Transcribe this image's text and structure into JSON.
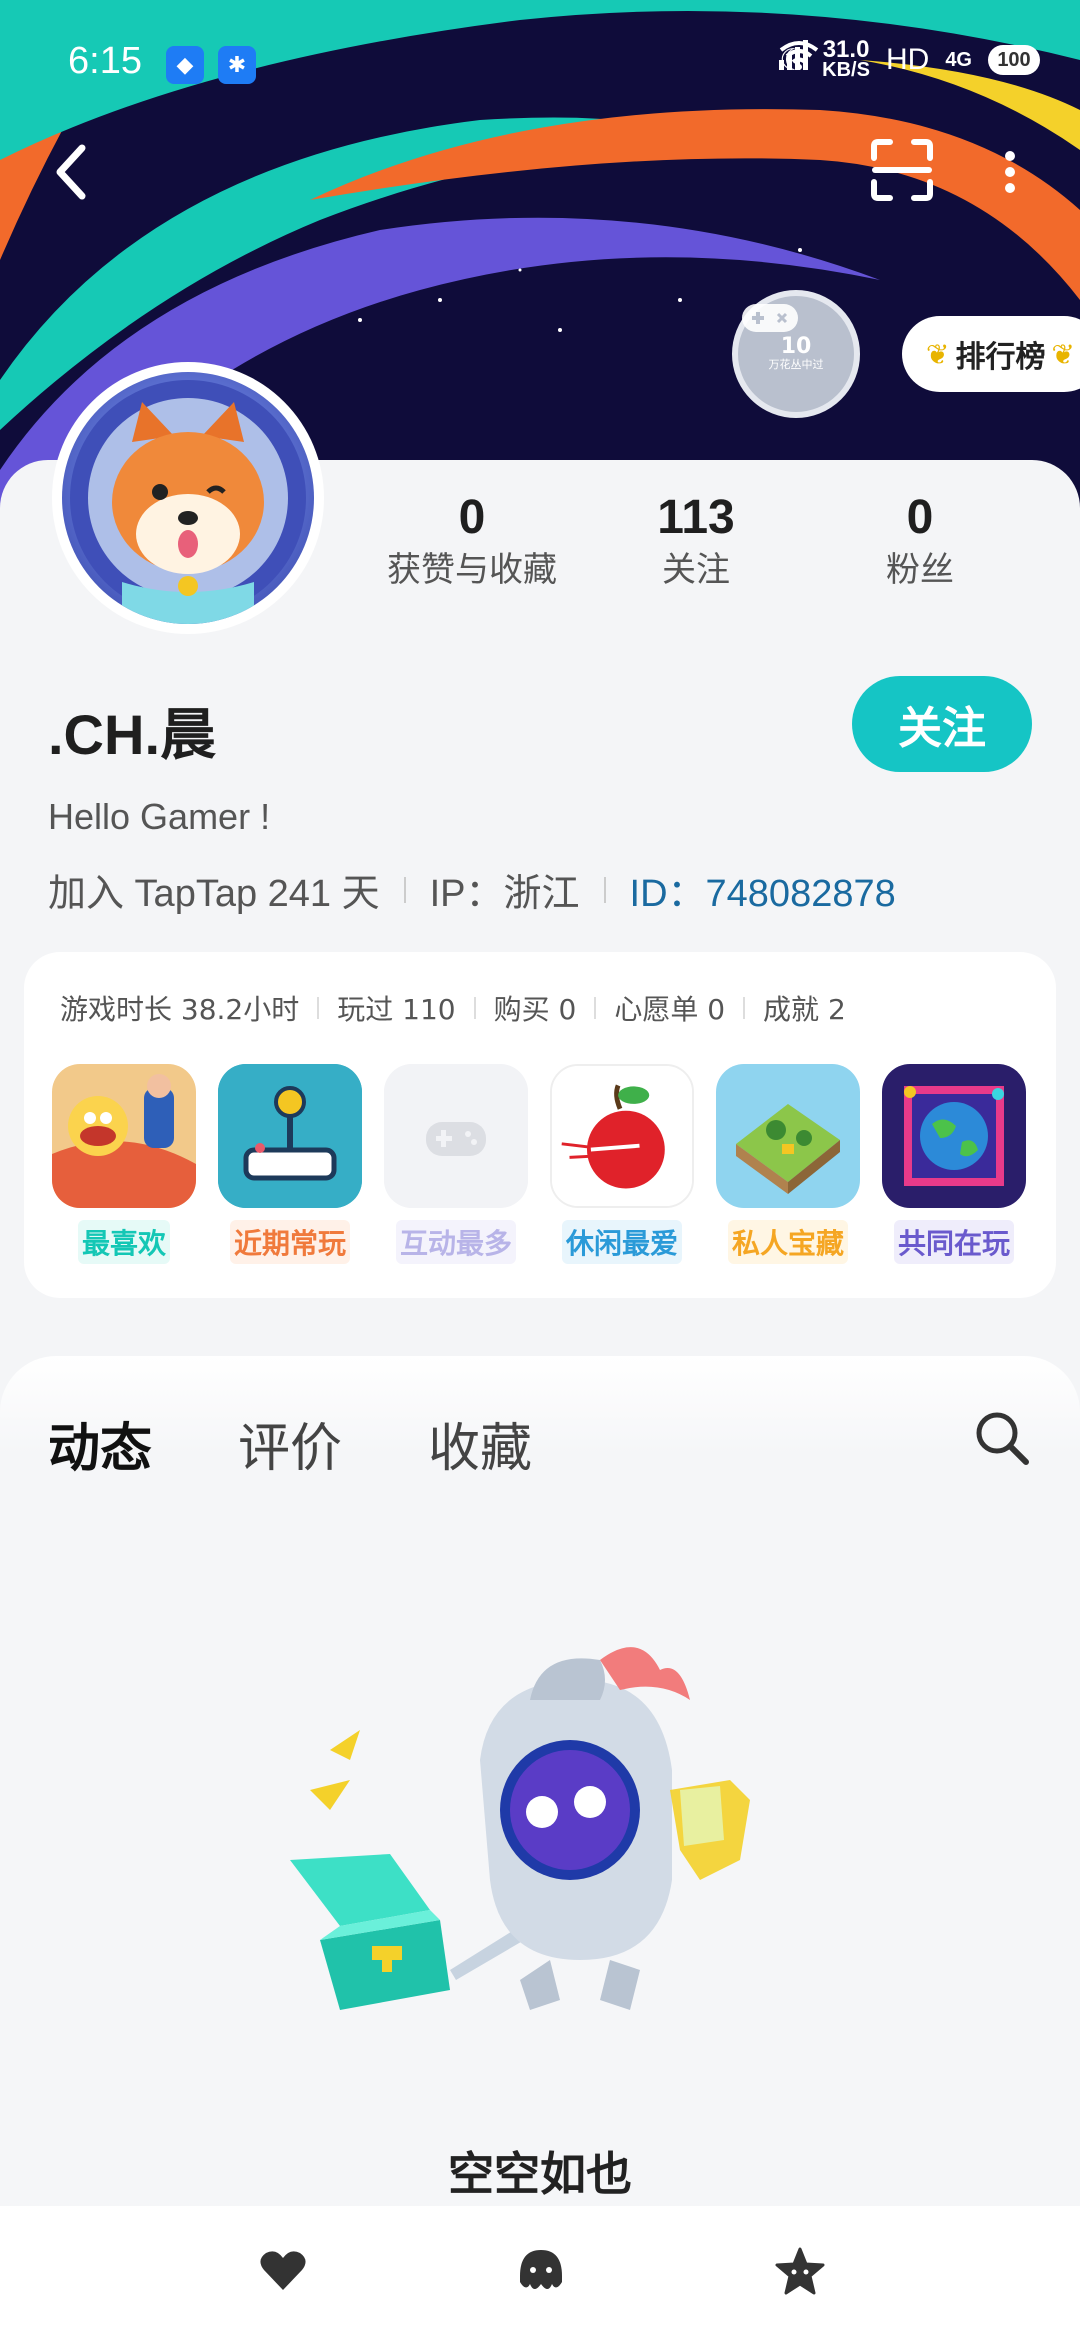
{
  "status_bar": {
    "time": "6:15",
    "speed_value": "31.0",
    "speed_unit": "KB/S",
    "network_hd": "HD",
    "network_gen": "4G",
    "battery": "100"
  },
  "header": {
    "badge_number": "10",
    "badge_text": "万花丛中过",
    "rank_label": "排行榜"
  },
  "profile": {
    "stats": [
      {
        "value": "0",
        "label": "获赞与收藏"
      },
      {
        "value": "113",
        "label": "关注"
      },
      {
        "value": "0",
        "label": "粉丝"
      }
    ],
    "name": ".CH.晨",
    "follow_label": "关注",
    "bio": "Hello Gamer !",
    "joined": "加入 TapTap 241 天",
    "ip": "IP：浙江",
    "id": "ID：748082878"
  },
  "game_card": {
    "stats": [
      "游戏时长 38.2小时",
      "玩过 110",
      "购买 0",
      "心愿单 0",
      "成就 2"
    ],
    "games": [
      {
        "label": "最喜欢",
        "color": "#14c7b5"
      },
      {
        "label": "近期常玩",
        "color": "#f07a3c"
      },
      {
        "label": "互动最多",
        "color": "#b8b4e8"
      },
      {
        "label": "休闲最爱",
        "color": "#2a9ad8"
      },
      {
        "label": "私人宝藏",
        "color": "#f5a623"
      },
      {
        "label": "共同在玩",
        "color": "#6a5acd"
      }
    ]
  },
  "tabs": [
    "动态",
    "评价",
    "收藏"
  ],
  "empty_text": "空空如也",
  "colors": {
    "accent": "#15c5c5",
    "banner_bg": "#0f0c3a"
  }
}
